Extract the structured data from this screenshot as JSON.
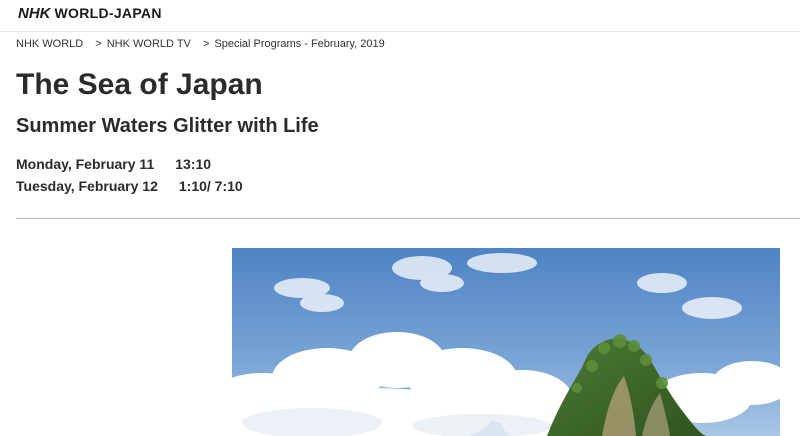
{
  "header": {
    "logo_nhk": "NHK",
    "logo_world_japan": "WORLD-JAPAN"
  },
  "breadcrumb": {
    "items": [
      "NHK WORLD",
      "NHK WORLD TV",
      "Special Programs - February, 2019"
    ],
    "separator": ">"
  },
  "program": {
    "title": "The Sea of Japan",
    "subtitle": "Summer Waters Glitter with Life",
    "schedule": [
      {
        "day": "Monday, February 11",
        "time": "13:10"
      },
      {
        "day": "Tuesday, February 12",
        "time": "1:10/ 7:10"
      }
    ]
  },
  "colors": {
    "text": "#2b2b2b",
    "divider": "#bdbdbd",
    "sky": "#5f8fc9",
    "cloud": "#ffffff",
    "foliage": "#3f6e2a"
  }
}
